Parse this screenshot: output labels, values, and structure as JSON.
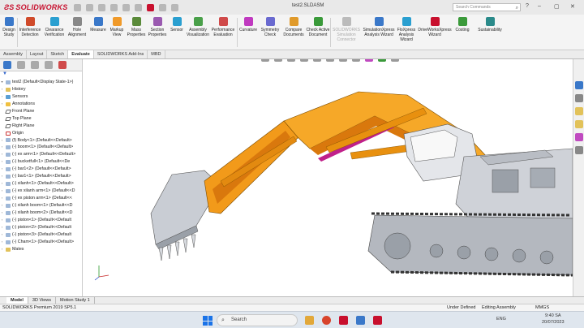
{
  "app": {
    "brand": "SOLIDWORKS",
    "doc_title": "test2.SLDASM"
  },
  "search": {
    "placeholder": "Search Commands"
  },
  "ribbon": {
    "items": [
      {
        "label": "Design Study",
        "color": "#3a78c9"
      },
      {
        "label": "Interference Detection",
        "color": "#d04a2a"
      },
      {
        "label": "Clearance Verification",
        "color": "#2a9fd0"
      },
      {
        "label": "Hole Alignment",
        "color": "#888888"
      },
      {
        "label": "Measure",
        "color": "#3a78c9"
      },
      {
        "label": "Markup View",
        "color": "#f09a2a"
      },
      {
        "label": "Mass Properties",
        "color": "#5a8a3a"
      },
      {
        "label": "Section Properties",
        "color": "#9a5ab0"
      },
      {
        "label": "Sensor",
        "color": "#2a9fd0"
      },
      {
        "label": "Assembly Visualization",
        "color": "#4aa04a"
      },
      {
        "label": "Performance Evaluation",
        "color": "#d04a4a"
      },
      {
        "label": "Curvature",
        "color": "#c03ac0"
      },
      {
        "label": "Symmetry Check",
        "color": "#6a6ad0"
      },
      {
        "label": "Compare Documents",
        "color": "#e09a2a"
      },
      {
        "label": "Check Active Document",
        "color": "#3a9a3a"
      },
      {
        "label": "SOLIDWORKS Simulation Connector",
        "color": "#bbbbbb",
        "disabled": true
      },
      {
        "label": "SimulationXpress Analysis Wizard",
        "color": "#3a78c9"
      },
      {
        "label": "FloXpress Analysis Wizard",
        "color": "#2a9fd0"
      },
      {
        "label": "DriveWorksXpress Wizard",
        "color": "#c8102e"
      },
      {
        "label": "Costing",
        "color": "#3a9a3a"
      },
      {
        "label": "Sustainability",
        "color": "#2a8a8a"
      }
    ]
  },
  "tabs": [
    "Assembly",
    "Layout",
    "Sketch",
    "Evaluate",
    "SOLIDWORKS Add-Ins",
    "MBD"
  ],
  "active_tab": "Evaluate",
  "tree": {
    "root": "test2 (Default<Display State-1>)",
    "items": [
      {
        "label": "History",
        "icon": "folder-icon"
      },
      {
        "label": "Sensors",
        "icon": "sensor-icon"
      },
      {
        "label": "Annotations",
        "icon": "annotations-icon"
      },
      {
        "label": "Front Plane",
        "icon": "plane-icon"
      },
      {
        "label": "Top Plane",
        "icon": "plane-icon"
      },
      {
        "label": "Right Plane",
        "icon": "plane-icon"
      },
      {
        "label": "Origin",
        "icon": "origin-icon"
      },
      {
        "label": "(f) Body<1> (Default<<Default>",
        "icon": "part-icon"
      },
      {
        "label": "(-) boom<1> (Default<<Default>",
        "icon": "part-icon"
      },
      {
        "label": "(-) ex arm<1> (Default<<Default>",
        "icon": "part-icon"
      },
      {
        "label": "(-) bucketfull<1> (Default<<De",
        "icon": "part-icon"
      },
      {
        "label": "(-) bar1<2> (Default<<Default>",
        "icon": "part-icon"
      },
      {
        "label": "(-) bar1<1> (Default<<Default>",
        "icon": "part-icon"
      },
      {
        "label": "(-) xilanh<1> (Default<<Default>",
        "icon": "part-icon"
      },
      {
        "label": "(-) ex xilanh arm<1> (Default<<D",
        "icon": "part-icon"
      },
      {
        "label": "(-) ex piston arm<1> (Default<<",
        "icon": "part-icon"
      },
      {
        "label": "(-) xilanh boom<1> (Default<<D",
        "icon": "part-icon"
      },
      {
        "label": "(-) xilanh boom<2> (Default<<D",
        "icon": "part-icon"
      },
      {
        "label": "(-) piston<1> (Default<<Default",
        "icon": "part-icon"
      },
      {
        "label": "(-) piston<2> (Default<<Default",
        "icon": "part-icon"
      },
      {
        "label": "(-) piston<3> (Default<<Default",
        "icon": "part-icon"
      },
      {
        "label": "(-) Cham<1> (Default<<Default>",
        "icon": "part-icon"
      },
      {
        "label": "Mates",
        "icon": "mates-icon"
      }
    ]
  },
  "model_tabs": [
    "Model",
    "3D Views",
    "Motion Study 1"
  ],
  "status": {
    "left": "SOLIDWORKS Premium 2019 SP5.1",
    "state": "Under Defined",
    "mode": "Editing Assembly",
    "units": "MMGS"
  },
  "taskbar": {
    "search": "Search",
    "lang": "ENG",
    "time": "9:40 SA",
    "date": "20/07/2023"
  }
}
